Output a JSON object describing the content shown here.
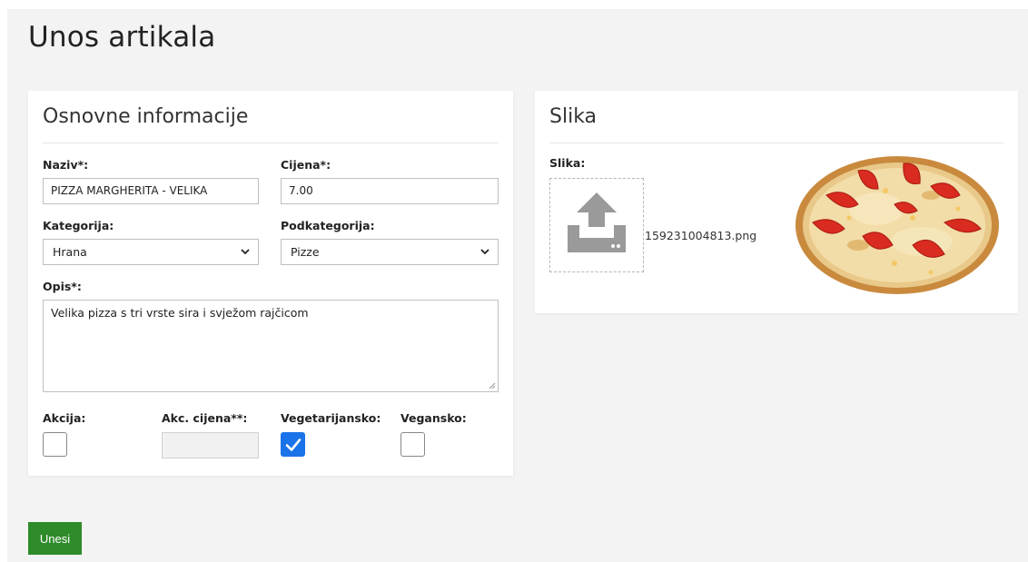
{
  "page": {
    "title": "Unos artikala"
  },
  "basic": {
    "title": "Osnovne informacije",
    "name_label": "Naziv*:",
    "name_value": "PIZZA MARGHERITA - VELIKA",
    "price_label": "Cijena*:",
    "price_value": "7.00",
    "category_label": "Kategorija:",
    "category_value": "Hrana",
    "subcategory_label": "Podkategorija:",
    "subcategory_value": "Pizze",
    "description_label": "Opis*:",
    "description_value": "Velika pizza s tri vrste sira i svježom rajčicom",
    "sale_label": "Akcija:",
    "sale_checked": false,
    "sale_price_label": "Akc. cijena**:",
    "sale_price_value": "",
    "vegetarian_label": "Vegetarijansko:",
    "vegetarian_checked": true,
    "vegan_label": "Vegansko:",
    "vegan_checked": false
  },
  "image": {
    "title": "Slika",
    "label": "Slika:",
    "filename": "159231004813.png",
    "upload_icon": "upload-icon"
  },
  "actions": {
    "submit_label": "Unesi"
  },
  "colors": {
    "accent": "#1a73e8",
    "submit": "#2e8b2a",
    "background": "#f3f3f3"
  }
}
